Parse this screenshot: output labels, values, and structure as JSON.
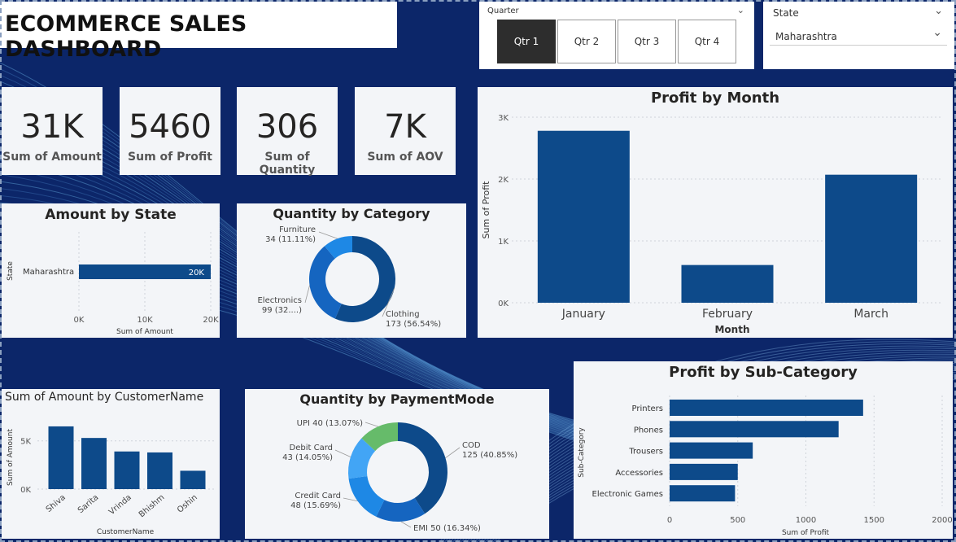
{
  "title": "ECOMMERCE SALES DASHBOARD",
  "quarter_slicer": {
    "label": "Quarter",
    "options": [
      "Qtr 1",
      "Qtr 2",
      "Qtr 3",
      "Qtr 4"
    ],
    "selected": "Qtr 1"
  },
  "state_slicer": {
    "label": "State",
    "selected": "Maharashtra"
  },
  "kpis": [
    {
      "value": "31K",
      "label": "Sum of Amount"
    },
    {
      "value": "5460",
      "label": "Sum of Profit"
    },
    {
      "value": "306",
      "label": "Sum of Quantity"
    },
    {
      "value": "7K",
      "label": "Sum of AOV"
    }
  ],
  "colors": {
    "bar": "#0d4a8a",
    "background": "#0c2669",
    "selected": "#2d2d2d",
    "donut": [
      "#0d4a8a",
      "#1565c0",
      "#1e88e5",
      "#42a5f5",
      "#66bb6a"
    ]
  },
  "chart_data": [
    {
      "type": "bar",
      "orientation": "horizontal",
      "title": "Amount by State",
      "ylabel": "State",
      "xlabel": "Sum of Amount",
      "categories": [
        "Maharashtra"
      ],
      "values": [
        20000
      ],
      "data_labels": [
        "20K"
      ],
      "xticks": [
        "0K",
        "10K",
        "20K"
      ],
      "xlim": [
        0,
        20000
      ]
    },
    {
      "type": "pie",
      "donut": true,
      "title": "Quantity by Category",
      "slices": [
        {
          "label": "Clothing",
          "value": 173,
          "text": "173 (56.54%)"
        },
        {
          "label": "Electronics",
          "value": 99,
          "text": "99 (32....)"
        },
        {
          "label": "Furniture",
          "value": 34,
          "text": "34 (11.11%)"
        }
      ]
    },
    {
      "type": "bar",
      "title": "Profit by Month",
      "xlabel": "Month",
      "ylabel": "Sum of Profit",
      "categories": [
        "January",
        "February",
        "March"
      ],
      "values": [
        2780,
        610,
        2070
      ],
      "yticks": [
        "0K",
        "1K",
        "2K",
        "3K"
      ],
      "ylim": [
        0,
        3000
      ]
    },
    {
      "type": "bar",
      "title": "Sum of Amount by CustomerName",
      "xlabel": "CustomerName",
      "ylabel": "Sum of Amount",
      "categories": [
        "Shiva",
        "Sarita",
        "Vrinda",
        "Bhishm",
        "Oshin"
      ],
      "values": [
        6500,
        5300,
        3900,
        3800,
        1900
      ],
      "yticks": [
        "0K",
        "5K"
      ],
      "ylim": [
        0,
        7000
      ]
    },
    {
      "type": "pie",
      "donut": true,
      "title": "Quantity by PaymentMode",
      "slices": [
        {
          "label": "COD",
          "value": 125,
          "text": "125 (40.85%)"
        },
        {
          "label": "EMI",
          "value": 50,
          "text": "EMI 50 (16.34%)"
        },
        {
          "label": "Credit Card",
          "value": 48,
          "text": "48 (15.69%)"
        },
        {
          "label": "Debit Card",
          "value": 43,
          "text": "43 (14.05%)"
        },
        {
          "label": "UPI",
          "value": 40,
          "text": "UPI 40 (13.07%)"
        }
      ]
    },
    {
      "type": "bar",
      "orientation": "horizontal",
      "title": "Profit by Sub-Category",
      "xlabel": "Sum of Profit",
      "ylabel": "Sub-Category",
      "categories": [
        "Printers",
        "Phones",
        "Trousers",
        "Accessories",
        "Electronic Games"
      ],
      "values": [
        1420,
        1240,
        610,
        500,
        480
      ],
      "xticks": [
        "0",
        "500",
        "1000",
        "1500",
        "2000"
      ],
      "xlim": [
        0,
        2000
      ]
    }
  ]
}
